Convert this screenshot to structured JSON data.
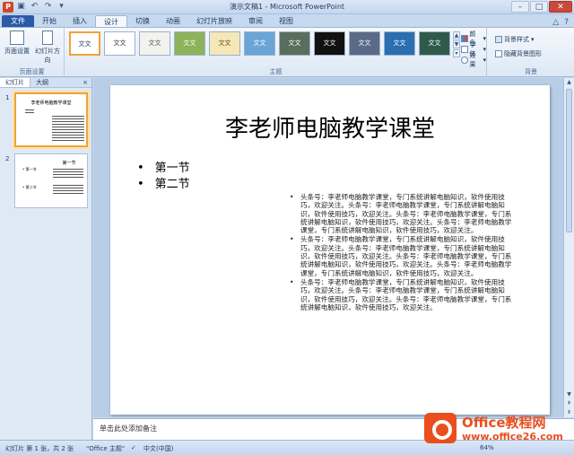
{
  "window": {
    "title": "演示文稿1 - Microsoft PowerPoint",
    "app_icon": "P",
    "controls": [
      "–",
      "□",
      "✕"
    ]
  },
  "tabs": [
    "文件",
    "开始",
    "插入",
    "设计",
    "切换",
    "动画",
    "幻灯片放映",
    "审阅",
    "视图"
  ],
  "active_tab": "设计",
  "ribbon": {
    "page_setup": {
      "label": "页面设置",
      "buttons": [
        "页面设置",
        "幻灯片方向"
      ]
    },
    "themes": {
      "label": "主题",
      "items": [
        {
          "text": "文文",
          "bg": "#ffffff",
          "fg": "#1e395b"
        },
        {
          "text": "文文",
          "bg": "#ffffff",
          "fg": "#333333"
        },
        {
          "text": "文文",
          "bg": "#f2f2ee",
          "fg": "#555555"
        },
        {
          "text": "文文",
          "bg": "#8db35a",
          "fg": "#ffffff"
        },
        {
          "text": "文文",
          "bg": "#f5e7b8",
          "fg": "#6b4a10"
        },
        {
          "text": "文文",
          "bg": "#6aa5d6",
          "fg": "#ffffff"
        },
        {
          "text": "文文",
          "bg": "#5a6e5e",
          "fg": "#ffffff"
        },
        {
          "text": "文文",
          "bg": "#111111",
          "fg": "#ffffff"
        },
        {
          "text": "文文",
          "bg": "#5b6a86",
          "fg": "#ffffff"
        },
        {
          "text": "文文",
          "bg": "#2b6fb0",
          "fg": "#ffffff"
        },
        {
          "text": "文文",
          "bg": "#2f5a4a",
          "fg": "#ffffff"
        }
      ],
      "side": [
        "颜色",
        "字体",
        "效果"
      ]
    },
    "background": {
      "label": "背景",
      "styles": "背景样式",
      "hide": "隐藏背景图形"
    }
  },
  "left_pane": {
    "tabs": [
      "幻灯片",
      "大纲"
    ],
    "close": "×",
    "slides": [
      {
        "num": "1",
        "title": "李老师电脑教学课堂"
      },
      {
        "num": "2",
        "title": "第一节",
        "item1": "第一节",
        "item2": "第二节"
      }
    ]
  },
  "slide": {
    "title": "李老师电脑教学课堂",
    "left_bullets": [
      "第一节",
      "第二节"
    ],
    "right_bullets": [
      "头条号：李老师电脑教学课堂，专门系统讲解电脑知识，软件使用技巧，欢迎关注。头条号：李老师电脑教学课堂，专门系统讲解电脑知识，软件使用技巧，欢迎关注。头条号：李老师电脑教学课堂，专门系统讲解电脑知识，软件使用技巧，欢迎关注。头条号：李老师电脑教学课堂，专门系统讲解电脑知识，软件使用技巧，欢迎关注。",
      "头条号：李老师电脑教学课堂，专门系统讲解电脑知识，软件使用技巧，欢迎关注。头条号：李老师电脑教学课堂，专门系统讲解电脑知识，软件使用技巧，欢迎关注。头条号：李老师电脑教学课堂，专门系统讲解电脑知识，软件使用技巧，欢迎关注。头条号：李老师电脑教学课堂，专门系统讲解电脑知识，软件使用技巧，欢迎关注。",
      "头条号：李老师电脑教学课堂，专门系统讲解电脑知识，软件使用技巧，欢迎关注。头条号：李老师电脑教学课堂，专门系统讲解电脑知识，软件使用技巧，欢迎关注。头条号：李老师电脑教学课堂，专门系统讲解电脑知识，软件使用技巧，欢迎关注。"
    ]
  },
  "notes_placeholder": "单击此处添加备注",
  "status": {
    "slide_info": "幻灯片 第 1 张，共 2 张",
    "theme": "\"Office 主题\"",
    "language": "中文(中国)",
    "zoom": "64%"
  },
  "logo": {
    "brand": "Office教程网",
    "site": "www.office26.com"
  }
}
